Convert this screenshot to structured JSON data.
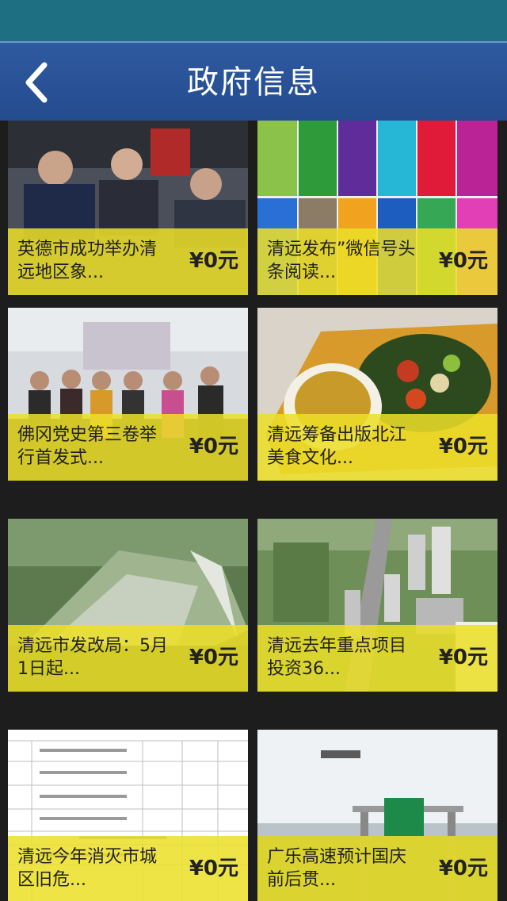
{
  "header": {
    "title": "政府信息",
    "back_icon": "chevron-left-icon"
  },
  "cards": [
    {
      "title": "英德市成功举办清远地区象...",
      "price": "¥0元"
    },
    {
      "title": "清远发布”微信号头条阅读...",
      "price": "¥0元"
    },
    {
      "title": "佛冈党史第三卷举行首发式...",
      "price": "¥0元"
    },
    {
      "title": "清远筹备出版北江美食文化...",
      "price": "¥0元"
    },
    {
      "title": "清远市发改局：5月1日起...",
      "price": "¥0元"
    },
    {
      "title": "清远去年重点项目投资36...",
      "price": "¥0元"
    },
    {
      "title": "清远今年消灭市城区旧危...",
      "price": "¥0元"
    },
    {
      "title": "广乐高速预计国庆前后贯...",
      "price": "¥0元"
    }
  ],
  "colors": {
    "status_bar": "#1e6f82",
    "header": "#2f5aa0",
    "overlay": "#ece028",
    "background": "#1d1d1d"
  }
}
